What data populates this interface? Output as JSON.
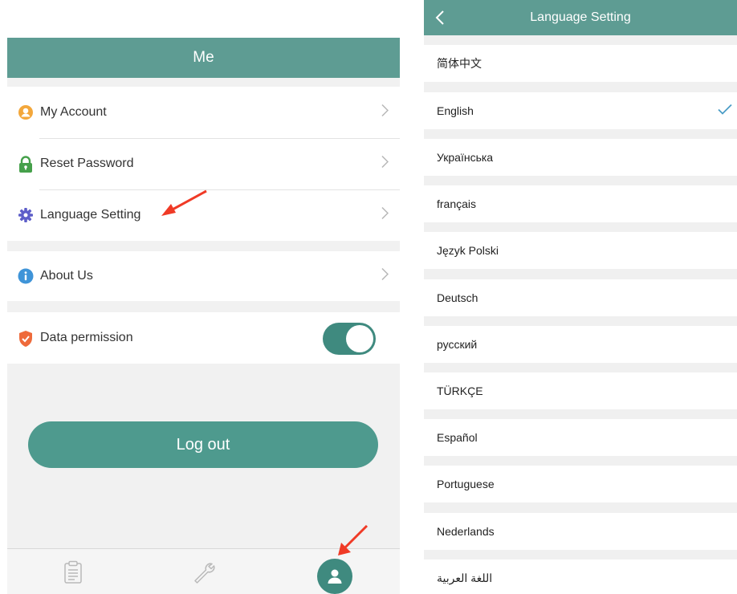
{
  "me": {
    "title": "Me",
    "items": [
      {
        "label": "My Account"
      },
      {
        "label": "Reset Password"
      },
      {
        "label": "Language Setting"
      },
      {
        "label": "About Us"
      },
      {
        "label": "Data permission",
        "toggle": "on"
      }
    ],
    "logout_label": "Log out",
    "tabs": [
      "clipboard-icon",
      "wrench-icon",
      "profile-icon"
    ],
    "colors": {
      "primary": "#5e9c93",
      "toggle": "#3f8a7f",
      "arrow": "#f03a26"
    }
  },
  "language": {
    "title": "Language Setting",
    "selected": "English",
    "items": [
      "简体中文",
      "English",
      "Українська",
      "français",
      "Język Polski",
      "Deutsch",
      "русский",
      "TÜRKÇE",
      "Español",
      "Portuguese",
      "Nederlands",
      "اللغة العربية"
    ]
  }
}
